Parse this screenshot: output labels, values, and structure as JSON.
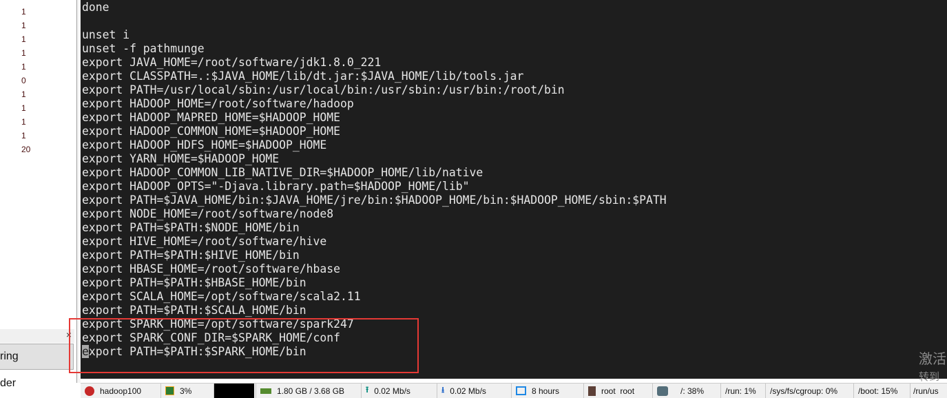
{
  "left_pane": {
    "numbers": [
      "1",
      "1",
      "1",
      "1",
      "1",
      "0",
      "1",
      "1",
      "1",
      "1",
      "20"
    ],
    "panel_close": "×",
    "button_label": "ring",
    "item_label": "der"
  },
  "terminal": {
    "lines": [
      "done",
      "",
      "unset i",
      "unset -f pathmunge",
      "export JAVA_HOME=/root/software/jdk1.8.0_221",
      "export CLASSPATH=.:$JAVA_HOME/lib/dt.jar:$JAVA_HOME/lib/tools.jar",
      "export PATH=/usr/local/sbin:/usr/local/bin:/usr/sbin:/usr/bin:/root/bin",
      "export HADOOP_HOME=/root/software/hadoop",
      "export HADOOP_MAPRED_HOME=$HADOOP_HOME",
      "export HADOOP_COMMON_HOME=$HADOOP_HOME",
      "export HADOOP_HDFS_HOME=$HADOOP_HOME",
      "export YARN_HOME=$HADOOP_HOME",
      "export HADOOP_COMMON_LIB_NATIVE_DIR=$HADOOP_HOME/lib/native",
      "export HADOOP_OPTS=\"-Djava.library.path=$HADOOP_HOME/lib\"",
      "export PATH=$JAVA_HOME/bin:$JAVA_HOME/jre/bin:$HADOOP_HOME/bin:$HADOOP_HOME/sbin:$PATH",
      "export NODE_HOME=/root/software/node8",
      "export PATH=$PATH:$NODE_HOME/bin",
      "export HIVE_HOME=/root/software/hive",
      "export PATH=$PATH:$HIVE_HOME/bin",
      "export HBASE_HOME=/root/software/hbase",
      "export PATH=$PATH:$HBASE_HOME/bin",
      "export SCALA_HOME=/opt/software/scala2.11",
      "export PATH=$PATH:$SCALA_HOME/bin",
      "export SPARK_HOME=/opt/software/spark247",
      "export SPARK_CONF_DIR=$SPARK_HOME/conf"
    ],
    "cursor_char": "e",
    "cursor_line_rest": "xport PATH=$PATH:$SPARK_HOME/bin",
    "highlight_color": "#e53935"
  },
  "watermark": {
    "line1": "激活",
    "line2": "转到"
  },
  "status_bar": {
    "host": "hadoop100",
    "cpu": "3%",
    "memory": "1.80 GB / 3.68 GB",
    "upload": "0.02 Mb/s",
    "download": "0.02 Mb/s",
    "uptime": "8 hours",
    "user": "root  root",
    "disk_root": "/: 38%",
    "disk_run": "/run: 1%",
    "disk_cgroup": "/sys/fs/cgroup: 0%",
    "disk_boot": "/boot: 15%",
    "disk_run_user": "/run/us"
  }
}
